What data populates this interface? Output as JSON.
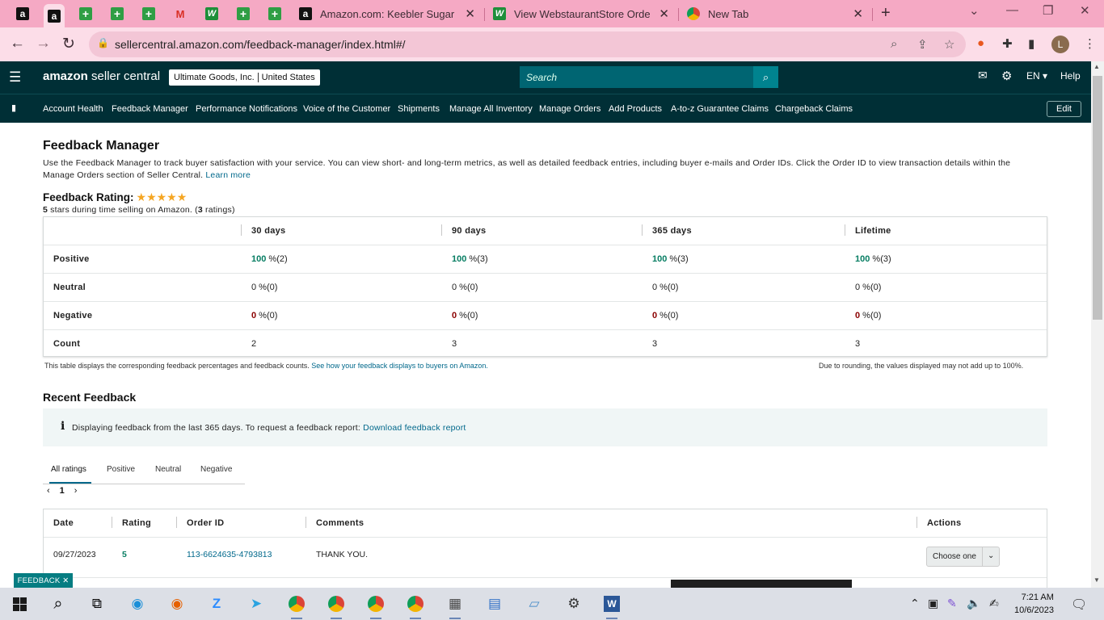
{
  "browser": {
    "tabs": [
      {
        "title": "Amazon.com: Keebler Sugar Wa"
      },
      {
        "title": "View WebstaurantStore Orders"
      },
      {
        "title": "New Tab"
      }
    ],
    "url": "sellercentral.amazon.com/feedback-manager/index.html#/",
    "profile_initial": "L"
  },
  "header": {
    "brand_prefix": "amazon",
    "brand_suffix": " seller central",
    "store_name": "Ultimate Goods, Inc.",
    "marketplace": "United States",
    "search_placeholder": "Search",
    "language": "EN",
    "help": "Help"
  },
  "nav": {
    "items": [
      "Account Health",
      "Feedback Manager",
      "Performance Notifications",
      "Voice of the Customer",
      "Shipments",
      "Manage All Inventory",
      "Manage Orders",
      "Add Products",
      "A-to-z Guarantee Claims",
      "Chargeback Claims"
    ],
    "edit": "Edit"
  },
  "page": {
    "title": "Feedback Manager",
    "intro": "Use the Feedback Manager to track buyer satisfaction with your service. You can view short- and long-term metrics, as well as detailed feedback entries, including buyer e-mails and Order IDs. Click the Order ID to view transaction details within the Manage Orders section of Seller Central.",
    "learn_more": "Learn more",
    "rating_label": "Feedback Rating:",
    "rating_stars": 5,
    "rating_sub_bold": "5",
    "rating_sub": " stars during time selling on Amazon. (",
    "rating_count": "3",
    "rating_sub_end": " ratings)"
  },
  "metrics_table": {
    "columns": [
      "30 days",
      "90 days",
      "365 days",
      "Lifetime"
    ],
    "rows": [
      {
        "label": "Positive",
        "cells": [
          {
            "pct": "100",
            "count": "(2)"
          },
          {
            "pct": "100",
            "count": "(3)"
          },
          {
            "pct": "100",
            "count": "(3)"
          },
          {
            "pct": "100",
            "count": "(3)"
          }
        ]
      },
      {
        "label": "Neutral",
        "cells": [
          {
            "pct": "0",
            "count": "(0)"
          },
          {
            "pct": "0",
            "count": "(0)"
          },
          {
            "pct": "0",
            "count": "(0)"
          },
          {
            "pct": "0",
            "count": "(0)"
          }
        ]
      },
      {
        "label": "Negative",
        "cells": [
          {
            "pct": "0",
            "count": "(0)"
          },
          {
            "pct": "0",
            "count": "(0)"
          },
          {
            "pct": "0",
            "count": "(0)"
          },
          {
            "pct": "0",
            "count": "(0)"
          }
        ]
      },
      {
        "label": "Count",
        "cells": [
          {
            "value": "2"
          },
          {
            "value": "3"
          },
          {
            "value": "3"
          },
          {
            "value": "3"
          }
        ]
      }
    ],
    "pct_suffix": " %",
    "note_left": "This table displays the corresponding feedback percentages and feedback counts.",
    "note_link": "See how your feedback displays to buyers on Amazon.",
    "note_right": "Due to rounding, the values displayed may not add up to 100%."
  },
  "recent": {
    "title": "Recent Feedback",
    "info_text": "Displaying feedback from the last 365 days. To request a feedback report:",
    "info_link": "Download feedback report",
    "tabs": [
      "All ratings",
      "Positive",
      "Neutral",
      "Negative"
    ],
    "page": "1",
    "columns": [
      "Date",
      "Rating",
      "Order ID",
      "Comments",
      "Actions"
    ],
    "rows": [
      {
        "date": "09/27/2023",
        "rating": "5",
        "order_id": "113-6624635-4793813",
        "comment": "THANK YOU.",
        "action": "Choose one"
      }
    ]
  },
  "feedback_tag": "FEEDBACK",
  "taskbar": {
    "time": "7:21 AM",
    "date": "10/6/2023"
  }
}
